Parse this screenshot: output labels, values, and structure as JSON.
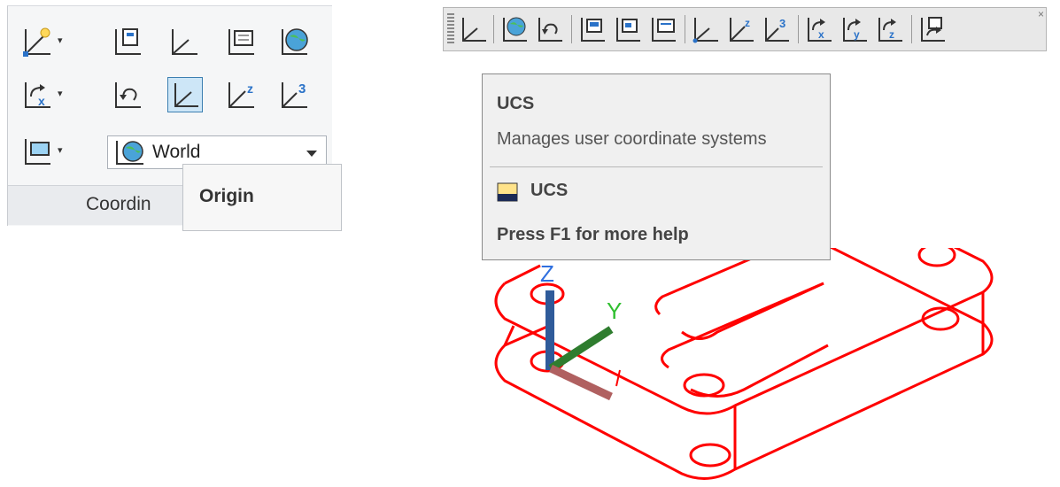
{
  "ribbon": {
    "coordinate_selector": {
      "value": "World"
    },
    "panel_title": "Coordin",
    "origin_tooltip": "Origin",
    "row1_icons": [
      "ucs-named-icon",
      "ucs-view-icon",
      "ucs-world-icon",
      "ucs-object-icon",
      "ucs-globe-icon"
    ],
    "row2_icons": [
      "ucs-rotate-x-icon",
      "ucs-previous-icon",
      "ucs-origin-icon",
      "ucs-z-axis-icon",
      "ucs-3point-icon"
    ],
    "row3_icons": [
      "ucs-face-icon"
    ]
  },
  "toolbar": {
    "icons": [
      "ucs-icon",
      "ucs-world-icon",
      "ucs-previous-icon",
      "ucs-face-icon",
      "ucs-object-icon",
      "ucs-view-icon",
      "ucs-origin-icon",
      "ucs-z-axis-icon",
      "ucs-3point-icon",
      "ucs-x-icon",
      "ucs-y-icon",
      "ucs-z-icon",
      "apply-icon"
    ]
  },
  "ucs_tooltip": {
    "title": "UCS",
    "description": "Manages user coordinate systems",
    "command": "UCS",
    "help": "Press F1 for more help"
  },
  "axis_labels": {
    "z": "Z",
    "y": "Y"
  },
  "colors": {
    "drawing": "#ff0000",
    "z_axis": "#2f5b9a",
    "y_axis": "#2f7d2f",
    "x_axis": "#b06060",
    "y_label": "#2fbf2f",
    "z_label": "#2f6fdf"
  }
}
